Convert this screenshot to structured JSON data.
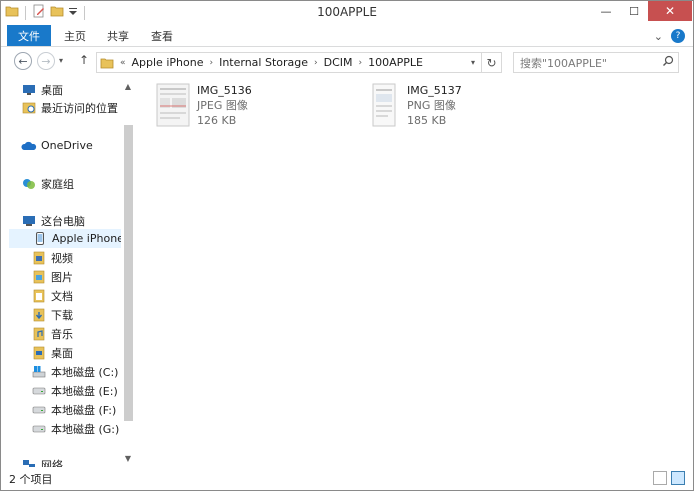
{
  "window": {
    "title": "100APPLE",
    "minimize_glyph": "—",
    "maximize_glyph": "☐",
    "close_glyph": "✕"
  },
  "ribbon": {
    "file_tab": "文件",
    "tabs": [
      "主页",
      "共享",
      "查看"
    ],
    "expand_glyph": "⌄",
    "help_glyph": "?"
  },
  "address": {
    "back_glyph": "←",
    "forward_glyph": "→",
    "up_glyph": "↑",
    "overflow": "«",
    "crumbs": [
      "Apple iPhone",
      "Internal Storage",
      "DCIM",
      "100APPLE"
    ],
    "separator": "›",
    "refresh_glyph": "↻"
  },
  "search": {
    "placeholder": "搜索\"100APPLE\"",
    "icon_glyph": "⚲"
  },
  "nav": {
    "items": [
      {
        "label": "桌面",
        "icon": "desktop-icon"
      },
      {
        "label": "最近访问的位置",
        "icon": "recent-places-icon"
      },
      {
        "label": "OneDrive",
        "icon": "onedrive-icon"
      },
      {
        "label": "家庭组",
        "icon": "homegroup-icon"
      },
      {
        "label": "这台电脑",
        "icon": "this-pc-icon"
      },
      {
        "label": "Apple iPhone",
        "icon": "phone-icon"
      },
      {
        "label": "视频",
        "icon": "videos-folder-icon"
      },
      {
        "label": "图片",
        "icon": "pictures-folder-icon"
      },
      {
        "label": "文档",
        "icon": "documents-folder-icon"
      },
      {
        "label": "下载",
        "icon": "downloads-folder-icon"
      },
      {
        "label": "音乐",
        "icon": "music-folder-icon"
      },
      {
        "label": "桌面",
        "icon": "desktop-folder-icon"
      },
      {
        "label": "本地磁盘 (C:)",
        "icon": "system-drive-icon"
      },
      {
        "label": "本地磁盘 (E:)",
        "icon": "drive-icon"
      },
      {
        "label": "本地磁盘 (F:)",
        "icon": "drive-icon"
      },
      {
        "label": "本地磁盘 (G:)",
        "icon": "drive-icon"
      },
      {
        "label": "网络",
        "icon": "network-icon"
      }
    ]
  },
  "files": [
    {
      "name": "IMG_5136",
      "type": "JPEG 图像",
      "size": "126 KB"
    },
    {
      "name": "IMG_5137",
      "type": "PNG 图像",
      "size": "185 KB"
    }
  ],
  "status": {
    "count": "2 个项目"
  },
  "colors": {
    "file_tab": "#1979ca",
    "close_button": "#c75050",
    "selection": "#e5f3ff"
  }
}
